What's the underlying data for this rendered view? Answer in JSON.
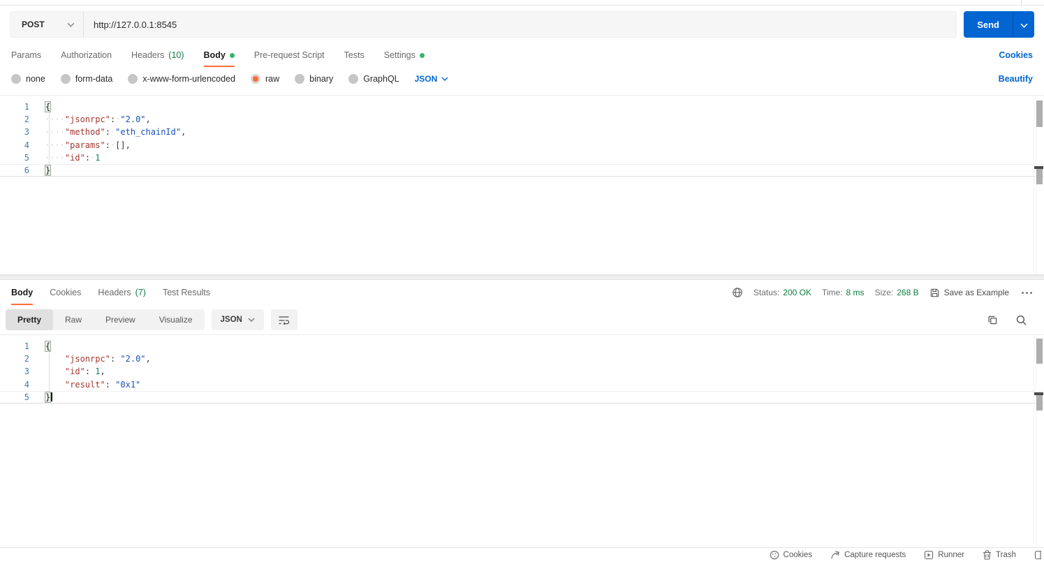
{
  "topbar": {
    "method": "POST",
    "url": "http://127.0.0.1:8545",
    "send_label": "Send"
  },
  "request_tabs": {
    "items": [
      {
        "label": "Params"
      },
      {
        "label": "Authorization"
      },
      {
        "label": "Headers",
        "count": "(10)"
      },
      {
        "label": "Body",
        "dot": true,
        "active": true
      },
      {
        "label": "Pre-request Script"
      },
      {
        "label": "Tests"
      },
      {
        "label": "Settings",
        "dot": true
      }
    ],
    "cookies_link": "Cookies"
  },
  "body_type": {
    "options": [
      {
        "label": "none"
      },
      {
        "label": "form-data"
      },
      {
        "label": "x-www-form-urlencoded"
      },
      {
        "label": "raw",
        "selected": true
      },
      {
        "label": "binary"
      },
      {
        "label": "GraphQL"
      }
    ],
    "language": "JSON",
    "beautify_link": "Beautify"
  },
  "request_editor": {
    "lines": [
      {
        "num": "1",
        "segs": [
          {
            "t": "{",
            "s": "bracket"
          }
        ]
      },
      {
        "num": "2",
        "segs": [
          {
            "t": "····",
            "s": "ws"
          },
          {
            "t": "\"jsonrpc\"",
            "s": "key"
          },
          {
            "t": ":",
            "s": "p"
          },
          {
            "t": "·",
            "s": "ws"
          },
          {
            "t": "\"2.0\"",
            "s": "str"
          },
          {
            "t": ",",
            "s": "p"
          }
        ]
      },
      {
        "num": "3",
        "segs": [
          {
            "t": "····",
            "s": "ws"
          },
          {
            "t": "\"method\"",
            "s": "key"
          },
          {
            "t": ":",
            "s": "p"
          },
          {
            "t": "·",
            "s": "ws"
          },
          {
            "t": "\"eth_chainId\"",
            "s": "str"
          },
          {
            "t": ",",
            "s": "p"
          }
        ]
      },
      {
        "num": "4",
        "segs": [
          {
            "t": "····",
            "s": "ws"
          },
          {
            "t": "\"params\"",
            "s": "key"
          },
          {
            "t": ":",
            "s": "p"
          },
          {
            "t": "·",
            "s": "ws"
          },
          {
            "t": "[],",
            "s": "p"
          }
        ]
      },
      {
        "num": "5",
        "segs": [
          {
            "t": "····",
            "s": "ws"
          },
          {
            "t": "\"id\"",
            "s": "key"
          },
          {
            "t": ":",
            "s": "p"
          },
          {
            "t": "·",
            "s": "ws"
          },
          {
            "t": "1",
            "s": "num"
          }
        ]
      },
      {
        "num": "6",
        "active": true,
        "segs": [
          {
            "t": "}",
            "s": "bracket"
          }
        ]
      }
    ]
  },
  "response": {
    "tabs": [
      {
        "label": "Body",
        "active": true
      },
      {
        "label": "Cookies"
      },
      {
        "label": "Headers",
        "count": "(7)"
      },
      {
        "label": "Test Results"
      }
    ],
    "status_label": "Status:",
    "status_value": "200 OK",
    "time_label": "Time:",
    "time_value": "8 ms",
    "size_label": "Size:",
    "size_value": "268 B",
    "save_as_example": "Save as Example",
    "views": [
      {
        "label": "Pretty",
        "active": true
      },
      {
        "label": "Raw"
      },
      {
        "label": "Preview"
      },
      {
        "label": "Visualize"
      }
    ],
    "language": "JSON"
  },
  "response_editor": {
    "lines": [
      {
        "num": "1",
        "segs": [
          {
            "t": "{",
            "s": "bracket"
          }
        ]
      },
      {
        "num": "2",
        "segs": [
          {
            "t": "    ",
            "s": "sp"
          },
          {
            "t": "\"jsonrpc\"",
            "s": "key"
          },
          {
            "t": ": ",
            "s": "p"
          },
          {
            "t": "\"2.0\"",
            "s": "str"
          },
          {
            "t": ",",
            "s": "p"
          }
        ]
      },
      {
        "num": "3",
        "segs": [
          {
            "t": "    ",
            "s": "sp"
          },
          {
            "t": "\"id\"",
            "s": "key"
          },
          {
            "t": ": ",
            "s": "p"
          },
          {
            "t": "1",
            "s": "num"
          },
          {
            "t": ",",
            "s": "p"
          }
        ]
      },
      {
        "num": "4",
        "segs": [
          {
            "t": "    ",
            "s": "sp"
          },
          {
            "t": "\"result\"",
            "s": "key"
          },
          {
            "t": ": ",
            "s": "p"
          },
          {
            "t": "\"0x1\"",
            "s": "str"
          }
        ]
      },
      {
        "num": "5",
        "active": true,
        "cursor": true,
        "segs": [
          {
            "t": "}",
            "s": "bracket"
          }
        ]
      }
    ]
  },
  "statusbar": {
    "items": [
      {
        "label": "Cookies",
        "icon": "cookie-icon"
      },
      {
        "label": "Capture requests",
        "icon": "capture-requests-icon"
      },
      {
        "label": "Runner",
        "icon": "runner-icon"
      },
      {
        "label": "Trash",
        "icon": "trash-icon"
      }
    ]
  },
  "colors": {
    "accent_orange": "#ff6c37",
    "primary_blue": "#0265d2",
    "success_green": "#0f7d41",
    "dot_green": "#31b566"
  }
}
